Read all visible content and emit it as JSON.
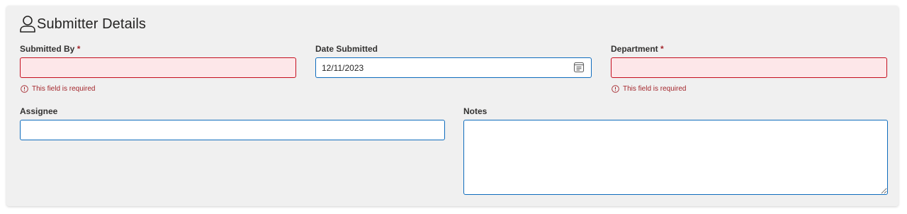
{
  "section": {
    "title": "Submitter Details",
    "icon": "user-icon"
  },
  "fields": {
    "submitted_by": {
      "label": "Submitted By",
      "required_mark": "*",
      "value": "",
      "placeholder": "",
      "error": "This field is required"
    },
    "date_submitted": {
      "label": "Date Submitted",
      "value": "12/11/2023",
      "icon": "calendar-icon"
    },
    "department": {
      "label": "Department",
      "required_mark": "*",
      "value": "",
      "placeholder": "",
      "error": "This field is required"
    },
    "assignee": {
      "label": "Assignee",
      "value": "",
      "placeholder": ""
    },
    "notes": {
      "label": "Notes",
      "value": "",
      "placeholder": ""
    }
  },
  "colors": {
    "focus_border": "#0f6cbd",
    "error_border": "#c50f1f",
    "error_background": "#fde7e9",
    "error_text": "#a4262c",
    "card_background": "#f0f0f0"
  }
}
